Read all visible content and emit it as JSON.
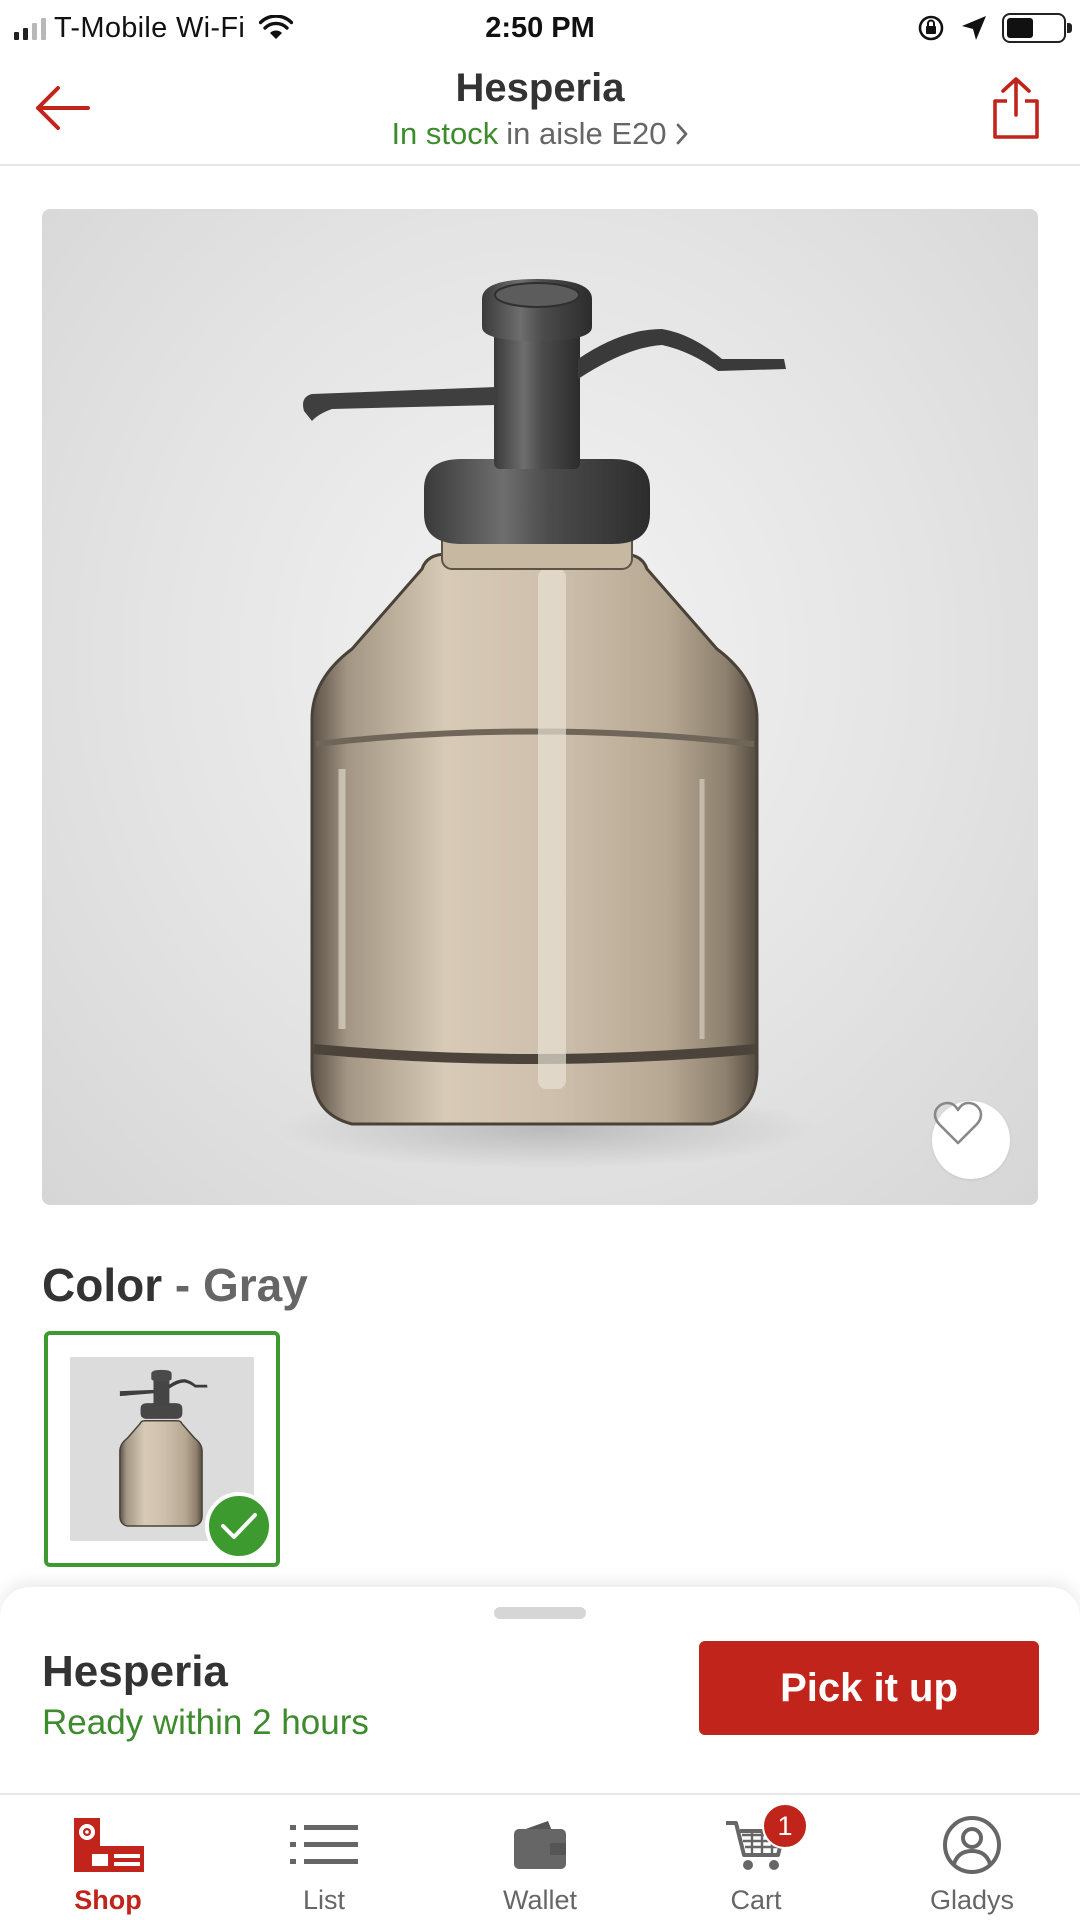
{
  "status_bar": {
    "carrier": "T-Mobile Wi-Fi",
    "time": "2:50 PM",
    "battery_level": 0.48
  },
  "header": {
    "title": "Hesperia",
    "stock_status": "In stock",
    "aisle_text": "in aisle E20"
  },
  "product": {
    "color_label": "Color",
    "color_separator": "-",
    "color_value": "Gray"
  },
  "bottom_sheet": {
    "title": "Hesperia",
    "subtitle": "Ready within 2 hours",
    "button_label": "Pick it up"
  },
  "tabs": [
    {
      "label": "Shop",
      "icon": "shop-icon",
      "active": true
    },
    {
      "label": "List",
      "icon": "list-icon",
      "active": false
    },
    {
      "label": "Wallet",
      "icon": "wallet-icon",
      "active": false
    },
    {
      "label": "Cart",
      "icon": "cart-icon",
      "active": false,
      "badge": "1"
    },
    {
      "label": "Gladys",
      "icon": "account-icon",
      "active": false
    }
  ],
  "colors": {
    "brand_red": "#c1241a",
    "in_stock_green": "#3d8b2c",
    "selected_green": "#3d9a2f"
  }
}
